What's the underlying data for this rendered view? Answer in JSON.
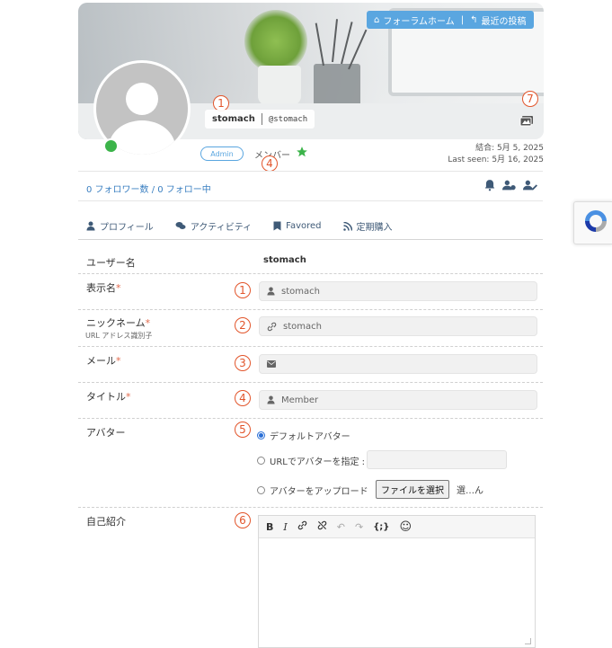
{
  "cover": {
    "nav_home": "フォーラムホーム",
    "nav_sep": "|",
    "nav_recent": "最近の投稿"
  },
  "profile": {
    "display_name": "stomach",
    "handle": "@stomach",
    "badge": "Admin",
    "role": "メンバー",
    "joined": "結合: 5月 5, 2025",
    "last_seen": "Last seen: 5月 16, 2025",
    "follow_text": "0 フォロワー数 / 0 フォロー中",
    "online": true
  },
  "tabs": [
    {
      "label": "プロフィール",
      "icon": "user-icon"
    },
    {
      "label": "アクティビティ",
      "icon": "comments-icon"
    },
    {
      "label": "Favored",
      "icon": "bookmark-icon"
    },
    {
      "label": "定期購入",
      "icon": "rss-icon"
    }
  ],
  "form": {
    "username_label": "ユーザー名",
    "username_value": "stomach",
    "display_label": "表示名",
    "display_value": "stomach",
    "nickname_label": "ニックネーム",
    "nickname_sub": "URL アドレス識別子",
    "nickname_value": "stomach",
    "email_label": "メール",
    "email_value": "",
    "title_label": "タイトル",
    "title_value": "Member",
    "avatar_label": "アバター",
    "avatar_opt1": "デフォルトアバター",
    "avatar_opt2": "URLでアバターを指定 :",
    "avatar_opt3": "アバターをアップロード",
    "file_button": "ファイルを選択",
    "file_status": "選…ん",
    "bio_label": "自己紹介",
    "required_mark": "*"
  },
  "annotations": {
    "n1": "1",
    "n2": "2",
    "n3": "3",
    "n4": "4",
    "n5": "5",
    "n6": "6",
    "n7": "7"
  },
  "colors": {
    "accent": "#5aa6e0",
    "link": "#3a7fc1",
    "required": "#e26a4d",
    "annotation": "#e2552b",
    "online": "#3cb44a",
    "star": "#3cb44a"
  }
}
